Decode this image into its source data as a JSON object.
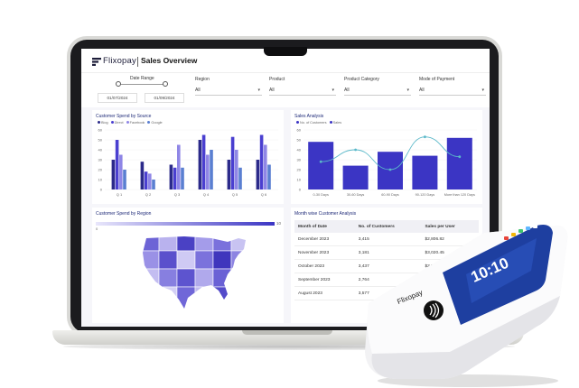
{
  "brand": {
    "name": "Flixopay",
    "accent": "#3b35c4",
    "accent_light": "#8f86e6",
    "accent_mid": "#5a68c9"
  },
  "header": {
    "title": "Sales Overview"
  },
  "filters": {
    "date_range": {
      "label": "Date Range",
      "start": "01/07/2024",
      "end": "01/09/2024"
    },
    "region": {
      "label": "Region",
      "value": "All"
    },
    "product": {
      "label": "Product",
      "value": "All"
    },
    "product_category": {
      "label": "Product Category",
      "value": "All"
    },
    "mode_of_payment": {
      "label": "Mode of Payment",
      "value": "All"
    }
  },
  "spend_by_source": {
    "title": "Customer Spend by Source",
    "legend": [
      "Blog",
      "Direct",
      "Facebook",
      "Google"
    ],
    "chart_data": {
      "type": "bar",
      "categories": [
        "Q 1",
        "Q 2",
        "Q 3",
        "Q 4",
        "Q 5",
        "Q 6"
      ],
      "ylim": [
        0,
        60
      ],
      "yticks": [
        "60",
        "50",
        "40",
        "30",
        "20",
        "10",
        "0"
      ],
      "series": [
        {
          "name": "Blog",
          "values": [
            30,
            28,
            25,
            50,
            30,
            30
          ]
        },
        {
          "name": "Direct",
          "values": [
            50,
            18,
            22,
            55,
            53,
            55
          ]
        },
        {
          "name": "Facebook",
          "values": [
            35,
            16,
            45,
            35,
            40,
            45
          ]
        },
        {
          "name": "Google",
          "values": [
            20,
            10,
            22,
            40,
            22,
            25
          ]
        }
      ]
    }
  },
  "sales_analysis": {
    "title": "Sales Analysis",
    "legend": [
      "No. of Customers",
      "Sales"
    ],
    "chart_data": {
      "type": "bar",
      "categories": [
        "0-30 Days",
        "30-60 Days",
        "60-90 Days",
        "90-120 Days",
        "More than 120 Days"
      ],
      "ylim": [
        0,
        60
      ],
      "yticks": [
        "60",
        "50",
        "40",
        "30",
        "20",
        "10",
        "0"
      ],
      "series": [
        {
          "name": "No. of Customers",
          "values": [
            48,
            24,
            38,
            34,
            52
          ]
        },
        {
          "name": "Sales",
          "values": [
            28,
            40,
            20,
            53,
            33
          ]
        }
      ]
    }
  },
  "spend_by_region": {
    "title": "Customer Spend by Region",
    "scale_min": "0",
    "scale_max": "10"
  },
  "month_analysis": {
    "title": "Month wise Customer Analysis",
    "columns": [
      "Month of Date",
      "No. of Customers",
      "Sales per User"
    ],
    "rows": [
      [
        "December 2023",
        "3,415",
        "$2,806.82"
      ],
      [
        "November 2023",
        "3,181",
        "$3,020.45"
      ],
      [
        "October 2023",
        "3,437",
        "$2,844.49"
      ],
      [
        "September 2023",
        "2,764",
        "$3,155.24"
      ],
      [
        "August 2023",
        "3,577",
        "$2,860.12"
      ]
    ]
  },
  "device": {
    "brand": "Flixopay",
    "clock": "10:10"
  }
}
